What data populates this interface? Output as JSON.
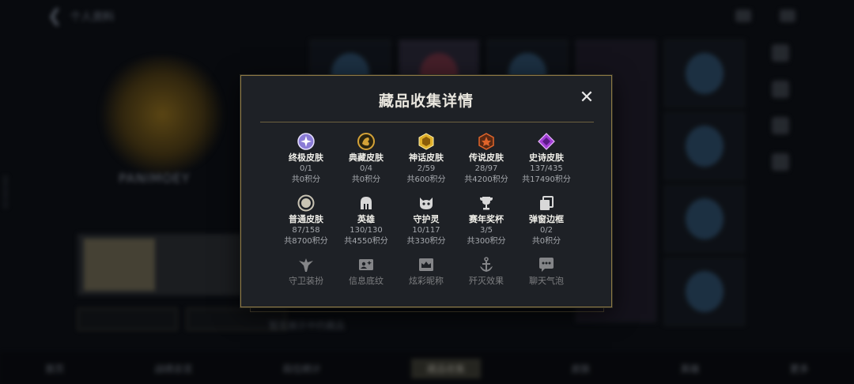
{
  "background": {
    "top_title": "个人资料",
    "name": "PANIMOEY",
    "sub": "",
    "side_id": "6843D036",
    "bottom_nav": [
      "首页",
      "战绩总览",
      "段位统计",
      "藏品收集",
      "皮肤",
      "英雄",
      "更多"
    ],
    "bottom_active_index": 3,
    "bar_text": "暂无展示中的藏品"
  },
  "dialog": {
    "title": "藏品收集详情",
    "close_label": "✕",
    "items": [
      {
        "label": "终极皮肤",
        "count": "0/1",
        "points": "共0积分",
        "icon": "ultimate-skin-icon",
        "color": "#8a7bd6"
      },
      {
        "label": "典藏皮肤",
        "count": "0/4",
        "points": "共0积分",
        "icon": "exalted-skin-icon",
        "color": "#d4a237"
      },
      {
        "label": "神话皮肤",
        "count": "2/59",
        "points": "共600积分",
        "icon": "mythic-skin-icon",
        "color": "#e0b02a"
      },
      {
        "label": "传说皮肤",
        "count": "28/97",
        "points": "共4200积分",
        "icon": "legendary-skin-icon",
        "color": "#e0642a"
      },
      {
        "label": "史诗皮肤",
        "count": "137/435",
        "points": "共17490积分",
        "icon": "epic-skin-icon",
        "color": "#a33ed6"
      },
      {
        "label": "普通皮肤",
        "count": "87/158",
        "points": "共8700积分",
        "icon": "common-skin-icon",
        "color": "#c9c4b4"
      },
      {
        "label": "英雄",
        "count": "130/130",
        "points": "共4550积分",
        "icon": "champion-helmet-icon",
        "color": "#d8d8d8"
      },
      {
        "label": "守护灵",
        "count": "10/117",
        "points": "共330积分",
        "icon": "guardian-spirit-icon",
        "color": "#d8d8d8"
      },
      {
        "label": "赛年奖杯",
        "count": "3/5",
        "points": "共300积分",
        "icon": "trophy-icon",
        "color": "#d8d8d8"
      },
      {
        "label": "弹窗边框",
        "count": "0/2",
        "points": "共0积分",
        "icon": "popup-frame-icon",
        "color": "#d8d8d8"
      },
      {
        "label": "守卫装扮",
        "icon": "ward-skin-icon",
        "color": "#d8d8d8"
      },
      {
        "label": "信息底纹",
        "icon": "info-banner-icon",
        "color": "#d8d8d8"
      },
      {
        "label": "炫彩昵称",
        "icon": "colorful-name-icon",
        "color": "#d8d8d8"
      },
      {
        "label": "歼灭效果",
        "icon": "ace-effect-icon",
        "color": "#d8d8d8"
      },
      {
        "label": "聊天气泡",
        "icon": "chat-bubble-icon",
        "color": "#d8d8d8"
      }
    ]
  },
  "colors": {
    "accent_gold": "#8f7a44",
    "dialog_bg": "#1e2126"
  }
}
